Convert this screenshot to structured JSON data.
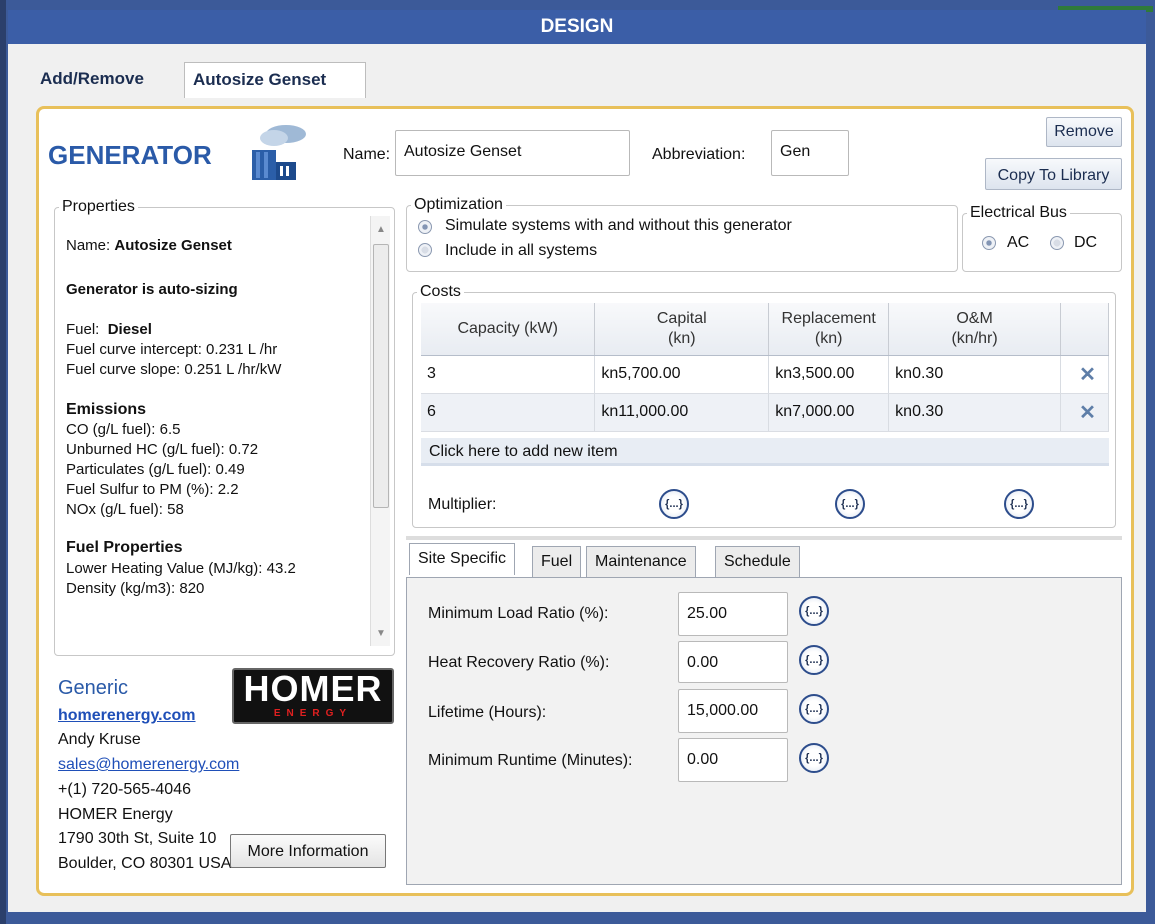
{
  "window": {
    "title": "DESIGN"
  },
  "tabs": [
    {
      "label": "Add/Remove"
    },
    {
      "label": "Autosize Genset"
    }
  ],
  "header": {
    "title": "GENERATOR",
    "name_label": "Name:",
    "name_value": "Autosize Genset",
    "abbr_label": "Abbreviation:",
    "abbr_value": "Gen",
    "remove_label": "Remove",
    "copy_label": "Copy To Library"
  },
  "properties": {
    "legend": "Properties",
    "name_prefix": "Name:",
    "name_value": "Autosize Genset",
    "autosize": "Generator is auto-sizing",
    "fuel_prefix": "Fuel:",
    "fuel_value": "Diesel",
    "intercept": "Fuel curve intercept:  0.231 L /hr",
    "slope": "Fuel curve slope:  0.251 L /hr/kW",
    "emissions_heading": "Emissions",
    "emissions": [
      "CO (g/L fuel): 6.5",
      "Unburned HC (g/L fuel): 0.72",
      "Particulates (g/L fuel): 0.49",
      "Fuel Sulfur to PM (%):  2.2",
      "NOx (g/L fuel): 58"
    ],
    "fuelprops_heading": "Fuel Properties",
    "fuelprops": [
      "Lower Heating Value (MJ/kg): 43.2",
      "Density (kg/m3): 820"
    ]
  },
  "optimization": {
    "legend": "Optimization",
    "option1": "Simulate systems with and without this generator",
    "option2": "Include in all systems",
    "selected": 1
  },
  "bus": {
    "legend": "Electrical Bus",
    "ac": "AC",
    "dc": "DC",
    "selected": "AC"
  },
  "costs": {
    "legend": "Costs",
    "headers": [
      "Capacity (kW)",
      "Capital\n(kn)",
      "Replacement\n(kn)",
      "O&M\n(kn/hr)"
    ],
    "rows": [
      [
        "3",
        "kn5,700.00",
        "kn3,500.00",
        "kn0.30"
      ],
      [
        "6",
        "kn11,000.00",
        "kn7,000.00",
        "kn0.30"
      ]
    ],
    "add_label": "Click here to add new item",
    "multiplier_label": "Multiplier:",
    "curly": "{...}"
  },
  "bottom_tabs": [
    "Site Specific",
    "Fuel",
    "Maintenance",
    "Schedule"
  ],
  "site": [
    {
      "label": "Minimum Load Ratio (%):",
      "value": "25.00"
    },
    {
      "label": "Heat Recovery Ratio (%):",
      "value": "0.00"
    },
    {
      "label": "Lifetime (Hours):",
      "value": "15,000.00"
    },
    {
      "label": "Minimum Runtime (Minutes):",
      "value": "0.00"
    }
  ],
  "contact": {
    "vendor": "Generic",
    "website": "homerenergy.com",
    "person": "Andy Kruse",
    "email": "sales@homerenergy.com",
    "phone": "+(1) 720-565-4046",
    "company": "HOMER Energy",
    "address1": "1790 30th St, Suite 10",
    "address2": "Boulder, CO 80301 USA",
    "more_info": "More Information"
  },
  "logo": {
    "main": "HOMER",
    "sub": "ENERGY"
  }
}
